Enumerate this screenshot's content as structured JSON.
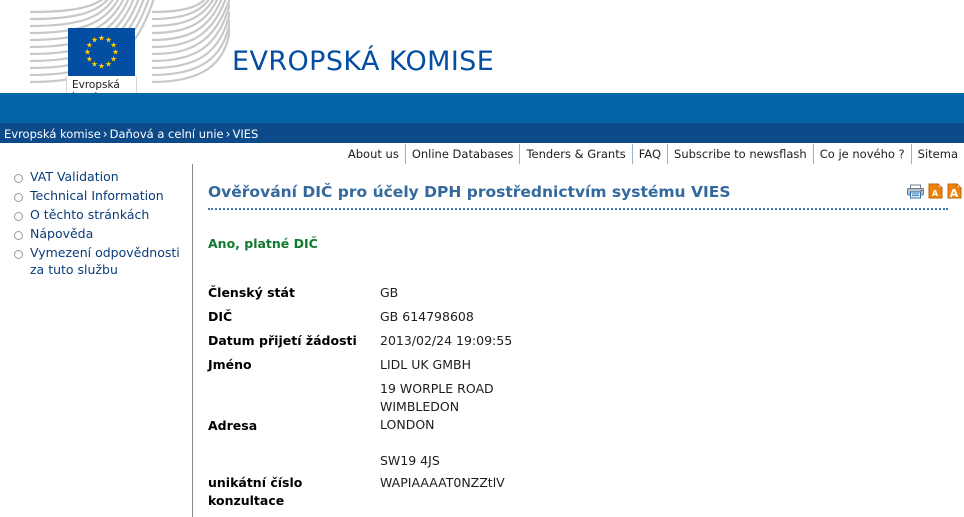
{
  "masthead": {
    "organisation_title": "EVROPSKÁ KOMISE",
    "logo_label_line1": "Evropská",
    "logo_label_line2": "komise",
    "logo_icon": "eu-flag-icon",
    "flag_star_count": 12,
    "colors": {
      "flag_blue": "#034ea2",
      "flag_star_yellow": "#ffcc00",
      "title_blue": "#034ea2",
      "band_light_blue": "#0365a8",
      "band_dark_blue": "#0d4a8a"
    }
  },
  "breadcrumb": {
    "items": [
      "Evropská komise",
      "Daňová a celní unie",
      "VIES"
    ],
    "separator": "›"
  },
  "navbar": {
    "items": [
      "About us",
      "Online Databases",
      "Tenders & Grants",
      "FAQ",
      "Subscribe to newsflash",
      "Co je nového ?",
      "Sitema"
    ]
  },
  "sidebar": {
    "items": [
      {
        "label": "VAT Validation",
        "continuation": ""
      },
      {
        "label": "Technical Information",
        "continuation": ""
      },
      {
        "label": "O těchto stránkách",
        "continuation": ""
      },
      {
        "label": "Nápověda",
        "continuation": ""
      },
      {
        "label": "Vymezení odpovědnosti",
        "continuation": "za tuto službu"
      }
    ]
  },
  "main": {
    "page_title": "Ověřování DIČ pro účely DPH prostřednictvím systému VIES",
    "status_message": "Ano, platné DIČ",
    "status_color": "#127a2e",
    "tools": [
      {
        "name": "print-icon",
        "title": "Print"
      },
      {
        "name": "decrease-font-icon",
        "title": "A"
      },
      {
        "name": "increase-font-icon",
        "title": "A"
      }
    ],
    "fields": [
      {
        "key": "Členský stát",
        "value": "GB"
      },
      {
        "key": "DIČ",
        "value": "GB 614798608"
      },
      {
        "key": "Datum přijetí žádosti",
        "value": "2013/02/24 19:09:55"
      },
      {
        "key": "Jméno",
        "value": "LIDL UK GMBH"
      }
    ],
    "address": {
      "key": "Adresa",
      "lines": [
        "19 WORPLE ROAD",
        "WIMBLEDON",
        "LONDON"
      ],
      "postcode": "SW19 4JS"
    },
    "consultation": {
      "key": "unikátní číslo konzultace",
      "value": "WAPIAAAAT0NZZtlV"
    }
  }
}
